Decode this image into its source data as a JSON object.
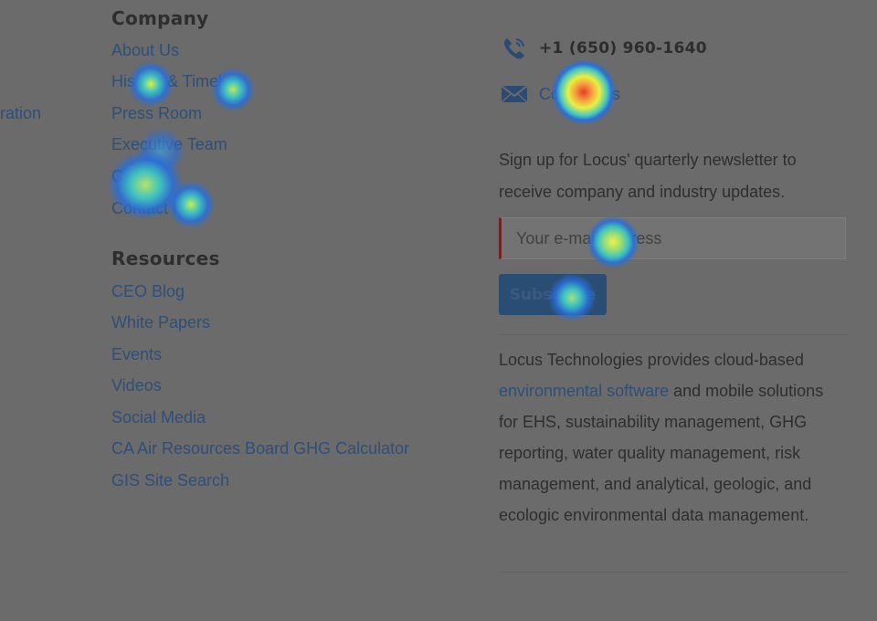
{
  "left_fragment": "ration",
  "company": {
    "heading": "Company",
    "links": [
      "About Us",
      "History & Timeline",
      "Press Room",
      "Executive Team",
      "Careers",
      "Contact Us"
    ]
  },
  "resources": {
    "heading": "Resources",
    "links": [
      "CEO Blog",
      "White Papers",
      "Events",
      "Videos",
      "Social Media",
      "CA Air Resources Board GHG Calculator",
      "GIS Site Search"
    ]
  },
  "contact": {
    "phone": "+1 (650) 960-1640",
    "email_link": "Contact Us",
    "phone_icon": "phone-icon",
    "email_icon": "envelope-icon"
  },
  "newsletter": {
    "text": "Sign up for Locus' quarterly newsletter to receive company and industry updates.",
    "placeholder": "Your e-mail address",
    "button": "Subscribe"
  },
  "about": {
    "before": "Locus Technologies provides cloud-based ",
    "link": "environmental software",
    "after": " and mobile solutions for EHS, sustainability management, GHG reporting, water quality management, risk management, and analytical, geologic, and ecologic environmental data management."
  },
  "colors": {
    "background": "#6b6b6c",
    "link": "#2d4f78",
    "button": "#2a4d73",
    "input_accent": "#6e2222"
  }
}
